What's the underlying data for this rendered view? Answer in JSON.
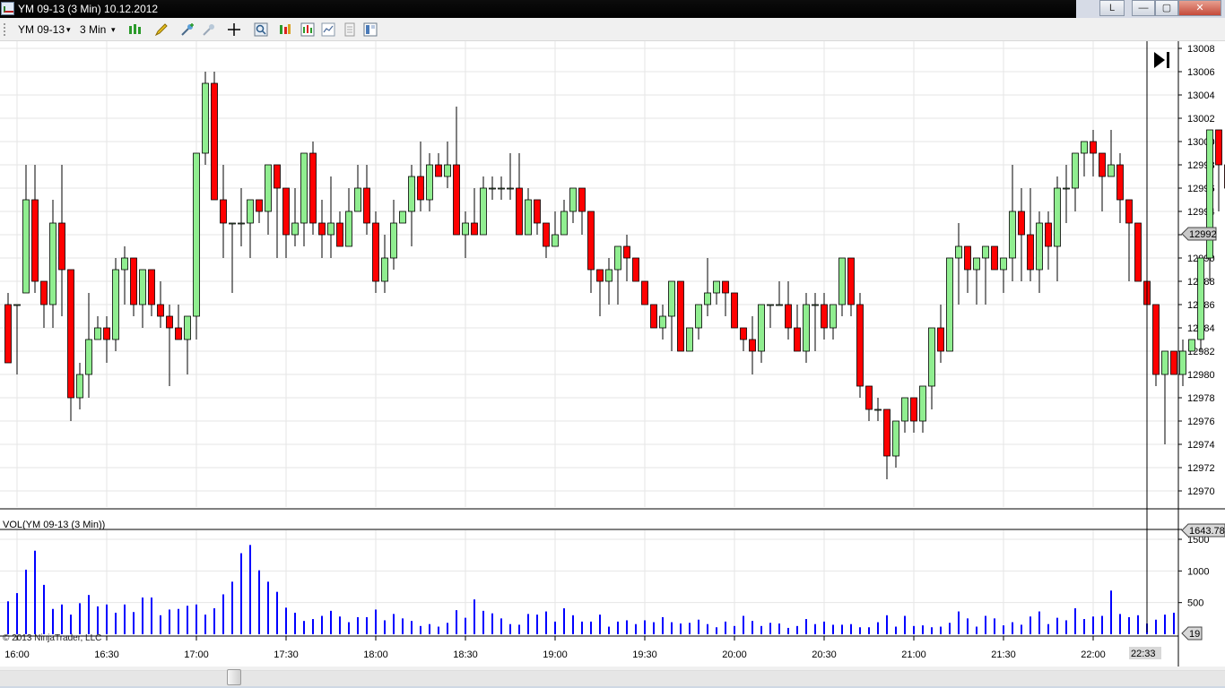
{
  "window": {
    "title": "YM 09-13 (3 Min)  10.12.2012",
    "layout_button": "L",
    "minimize": "—",
    "maximize": "▢",
    "close": "✕"
  },
  "toolbar": {
    "instrument": "YM 09-13",
    "interval": "3 Min",
    "dropdown_arrow": "▾",
    "icons": [
      "bar-type-icon",
      "drawing-tool-icon",
      "zoom-in-icon",
      "zoom-out-icon",
      "crosshair-icon",
      "search-icon",
      "chart-properties-icon",
      "indicators-icon",
      "strategies-icon",
      "data-box-icon",
      "chart-trader-icon"
    ]
  },
  "colors": {
    "up_fill": "#90ee90",
    "down_fill": "#ff0000",
    "volume": "#0000ff",
    "grid": "#e6e6e6",
    "crosshair": "#000000"
  },
  "chart_data": [
    {
      "type": "candlestick",
      "instrument": "YM 09-13",
      "interval": "3 Min",
      "xlabel": "",
      "ylabel": "",
      "ylim": [
        12969,
        13008
      ],
      "x_ticks": [
        "16:00",
        "16:30",
        "17:00",
        "17:30",
        "18:00",
        "18:30",
        "19:00",
        "19:30",
        "20:00",
        "20:30",
        "21:00",
        "21:30",
        "22:00"
      ],
      "y_ticks": [
        13008,
        13006,
        13004,
        13002,
        13000,
        12998,
        12996,
        12994,
        12992,
        12990,
        12988,
        12986,
        12984,
        12982,
        12980,
        12978,
        12976,
        12974,
        12972,
        12970
      ],
      "current_price_label": "12992",
      "current_time_label": "22:33",
      "ohlc": [
        [
          12986,
          12987,
          12981,
          12981
        ],
        [
          12986,
          12986,
          12980,
          12986
        ],
        [
          12987,
          12998,
          12987,
          12995
        ],
        [
          12995,
          12998,
          12987,
          12988
        ],
        [
          12988,
          12988,
          12984,
          12986
        ],
        [
          12986,
          12995,
          12984,
          12993
        ],
        [
          12993,
          12998,
          12985,
          12989
        ],
        [
          12989,
          12989,
          12976,
          12978
        ],
        [
          12978,
          12981,
          12977,
          12980
        ],
        [
          12980,
          12987,
          12978,
          12983
        ],
        [
          12983,
          12985,
          12983,
          12984
        ],
        [
          12984,
          12985,
          12981,
          12983
        ],
        [
          12983,
          12990,
          12982,
          12989
        ],
        [
          12989,
          12991,
          12986,
          12990
        ],
        [
          12990,
          12990,
          12985,
          12986
        ],
        [
          12986,
          12989,
          12984,
          12989
        ],
        [
          12989,
          12989,
          12985,
          12986
        ],
        [
          12986,
          12988,
          12984,
          12985
        ],
        [
          12985,
          12986,
          12979,
          12984
        ],
        [
          12984,
          12986,
          12983,
          12983
        ],
        [
          12983,
          12985,
          12980,
          12985
        ],
        [
          12985,
          12999,
          12983,
          12999
        ],
        [
          12999,
          13006,
          12998,
          13005
        ],
        [
          13005,
          13006,
          12995,
          12995
        ],
        [
          12995,
          12998,
          12990,
          12993
        ],
        [
          12993,
          12993,
          12987,
          12993
        ],
        [
          12993,
          12996,
          12991,
          12993
        ],
        [
          12993,
          12995,
          12990,
          12995
        ],
        [
          12995,
          12995,
          12993,
          12994
        ],
        [
          12994,
          12998,
          12992,
          12998
        ],
        [
          12998,
          12998,
          12990,
          12996
        ],
        [
          12996,
          12996,
          12990,
          12992
        ],
        [
          12992,
          12996,
          12991,
          12993
        ],
        [
          12993,
          12999,
          12991,
          12999
        ],
        [
          12999,
          13000,
          12992,
          12993
        ],
        [
          12993,
          12995,
          12990,
          12992
        ],
        [
          12992,
          12997,
          12990,
          12993
        ],
        [
          12993,
          12994,
          12991,
          12991
        ],
        [
          12991,
          12996,
          12991,
          12994
        ],
        [
          12994,
          12998,
          12994,
          12996
        ],
        [
          12996,
          12998,
          12992,
          12993
        ],
        [
          12993,
          12994,
          12987,
          12988
        ],
        [
          12988,
          12992,
          12987,
          12990
        ],
        [
          12990,
          12995,
          12989,
          12993
        ],
        [
          12993,
          12994,
          12993,
          12994
        ],
        [
          12994,
          12998,
          12991,
          12997
        ],
        [
          12997,
          13000,
          12994,
          12995
        ],
        [
          12995,
          12999,
          12994,
          12998
        ],
        [
          12998,
          12999,
          12997,
          12997
        ],
        [
          12997,
          13000,
          12996,
          12998
        ],
        [
          12998,
          13003,
          12992,
          12992
        ],
        [
          12992,
          12994,
          12990,
          12993
        ],
        [
          12993,
          12996,
          12992,
          12992
        ],
        [
          12992,
          12997,
          12992,
          12996
        ],
        [
          12996,
          12997,
          12995,
          12996
        ],
        [
          12996,
          12997,
          12995,
          12996
        ],
        [
          12996,
          12999,
          12995,
          12996
        ],
        [
          12996,
          12999,
          12992,
          12992
        ],
        [
          12992,
          12996,
          12994,
          12995
        ],
        [
          12995,
          12995,
          12992,
          12993
        ],
        [
          12993,
          12993,
          12990,
          12991
        ],
        [
          12991,
          12994,
          12991,
          12992
        ],
        [
          12992,
          12995,
          12992,
          12994
        ],
        [
          12994,
          12996,
          12993,
          12996
        ],
        [
          12996,
          12996,
          12992,
          12994
        ],
        [
          12994,
          12994,
          12987,
          12989
        ],
        [
          12989,
          12989,
          12985,
          12988
        ],
        [
          12988,
          12990,
          12986,
          12989
        ],
        [
          12989,
          12991,
          12986,
          12991
        ],
        [
          12991,
          12992,
          12988,
          12990
        ],
        [
          12990,
          12990,
          12988,
          12988
        ],
        [
          12988,
          12988,
          12986,
          12986
        ],
        [
          12986,
          12986,
          12984,
          12984
        ],
        [
          12984,
          12986,
          12983,
          12985
        ],
        [
          12985,
          12988,
          12982,
          12988
        ],
        [
          12988,
          12988,
          12982,
          12982
        ],
        [
          12982,
          12984,
          12982,
          12984
        ],
        [
          12984,
          12986,
          12983,
          12986
        ],
        [
          12986,
          12990,
          12985,
          12987
        ],
        [
          12987,
          12988,
          12986,
          12988
        ],
        [
          12988,
          12988,
          12985,
          12987
        ],
        [
          12987,
          12987,
          12985,
          12984
        ],
        [
          12984,
          12984,
          12982,
          12983
        ],
        [
          12983,
          12985,
          12980,
          12982
        ],
        [
          12982,
          12986,
          12981,
          12986
        ],
        [
          12986,
          12986,
          12984,
          12986
        ],
        [
          12986,
          12988,
          12986,
          12986
        ],
        [
          12986,
          12988,
          12983,
          12984
        ],
        [
          12984,
          12986,
          12982,
          12982
        ],
        [
          12982,
          12987,
          12981,
          12986
        ],
        [
          12986,
          12987,
          12982,
          12986
        ],
        [
          12986,
          12987,
          12983,
          12984
        ],
        [
          12984,
          12986,
          12983,
          12986
        ],
        [
          12986,
          12990,
          12985,
          12990
        ],
        [
          12990,
          12990,
          12985,
          12986
        ],
        [
          12986,
          12987,
          12978,
          12979
        ],
        [
          12979,
          12979,
          12976,
          12977
        ],
        [
          12977,
          12978,
          12976,
          12977
        ],
        [
          12977,
          12977,
          12971,
          12973
        ],
        [
          12973,
          12976,
          12972,
          12976
        ],
        [
          12976,
          12978,
          12975,
          12978
        ],
        [
          12978,
          12978,
          12975,
          12976
        ],
        [
          12976,
          12978,
          12975,
          12979
        ],
        [
          12979,
          12982,
          12977,
          12984
        ],
        [
          12984,
          12986,
          12981,
          12982
        ],
        [
          12982,
          12988,
          12982,
          12990
        ],
        [
          12990,
          12993,
          12986,
          12991
        ],
        [
          12991,
          12991,
          12987,
          12989
        ],
        [
          12989,
          12989,
          12986,
          12990
        ],
        [
          12990,
          12990,
          12986,
          12991
        ],
        [
          12991,
          12991,
          12989,
          12989
        ],
        [
          12989,
          12989,
          12987,
          12990
        ],
        [
          12990,
          12998,
          12988,
          12994
        ],
        [
          12994,
          12996,
          12988,
          12992
        ],
        [
          12992,
          12996,
          12988,
          12989
        ],
        [
          12989,
          12994,
          12987,
          12993
        ],
        [
          12993,
          12994,
          12989,
          12991
        ],
        [
          12991,
          12997,
          12988,
          12996
        ],
        [
          12996,
          12998,
          12993,
          12996
        ],
        [
          12996,
          12997,
          12994,
          12999
        ],
        [
          12999,
          13000,
          12997,
          13000
        ],
        [
          13000,
          13001,
          12997,
          12999
        ],
        [
          12999,
          12999,
          12994,
          12997
        ],
        [
          12997,
          13001,
          12997,
          12998
        ],
        [
          12998,
          12999,
          12993,
          12995
        ],
        [
          12995,
          12995,
          12988,
          12993
        ],
        [
          12993,
          12993,
          12988,
          12988
        ],
        [
          12988,
          12988,
          12985,
          12986
        ],
        [
          12986,
          12986,
          12979,
          12980
        ],
        [
          12980,
          12980,
          12974,
          12982
        ],
        [
          12982,
          12982,
          12980,
          12980
        ],
        [
          12980,
          12983,
          12979,
          12982
        ],
        [
          12982,
          12983,
          12982,
          12983
        ],
        [
          12983,
          12990,
          12982,
          12990
        ],
        [
          12990,
          13001,
          12988,
          13001
        ],
        [
          13001,
          12998,
          12994,
          12998
        ],
        [
          12998,
          12998,
          12994,
          12996
        ],
        [
          12996,
          12996,
          12994,
          12994
        ],
        [
          12994,
          12994,
          12990,
          12992
        ]
      ],
      "volume_bars": [
        [
          680,
          780,
          1200,
          1680,
          1060,
          740,
          940,
          470,
          810,
          1180,
          480,
          740,
          400,
          680,
          520,
          770,
          830,
          330,
          380,
          400,
          430,
          510,
          270,
          400,
          1200,
          1260,
          1020,
          870,
          740,
          400,
          340,
          350,
          250,
          310,
          330,
          210,
          540,
          140,
          260,
          330,
          210,
          330,
          0,
          130,
          310,
          220,
          120,
          170,
          560,
          550,
          380,
          350,
          220,
          120,
          180,
          580,
          130,
          470,
          230,
          210,
          130,
          280,
          180,
          180,
          170,
          180,
          200,
          160,
          170,
          200,
          180,
          200,
          170,
          140,
          170,
          210,
          140,
          480,
          210,
          200,
          180,
          160,
          190,
          150,
          140,
          130,
          180,
          180,
          230,
          150,
          280,
          300,
          310,
          190,
          130,
          230,
          100,
          240,
          120,
          200,
          100,
          130,
          160,
          120,
          120,
          140,
          160,
          100,
          130,
          200,
          120,
          180,
          130,
          150,
          100,
          120,
          190,
          310,
          110,
          610,
          530,
          260,
          180,
          140,
          100,
          400,
          300,
          300,
          260,
          230,
          220,
          620,
          400,
          460,
          120,
          230,
          470,
          140,
          560,
          420,
          480,
          310,
          310,
          200,
          240,
          540,
          470,
          160,
          190,
          180,
          400,
          350,
          240,
          620,
          580,
          480,
          680,
          430,
          740,
          150,
          640,
          500,
          500,
          280,
          520,
          0,
          0,
          0,
          0
        ]
      ],
      "volume": [
        520,
        650,
        1020,
        1320,
        780,
        400,
        470,
        310,
        490,
        620,
        440,
        470,
        340,
        470,
        350,
        580,
        580,
        300,
        390,
        400,
        450,
        470,
        310,
        410,
        630,
        830,
        1280,
        1410,
        1010,
        830,
        670,
        420,
        340,
        210,
        240,
        290,
        370,
        280,
        190,
        270,
        270,
        390,
        220,
        320,
        250,
        210,
        130,
        160,
        120,
        180,
        380,
        260,
        550,
        370,
        330,
        250,
        160,
        150,
        320,
        310,
        360,
        200,
        410,
        300,
        200,
        200,
        310,
        120,
        200,
        220,
        160,
        220,
        190,
        270,
        190,
        170,
        180,
        230,
        160,
        110,
        200,
        130,
        290,
        210,
        130,
        180,
        170,
        100,
        130,
        240,
        160,
        200,
        150,
        150,
        160,
        110,
        110,
        190,
        300,
        120,
        290,
        130,
        140,
        110,
        120,
        180,
        360,
        250,
        120,
        290,
        250,
        140,
        190,
        150,
        280,
        360,
        160,
        260,
        220,
        410,
        240,
        280,
        290,
        690,
        320,
        270,
        300,
        170,
        230,
        310,
        340,
        590,
        240,
        600,
        240,
        390,
        350,
        470,
        200,
        330,
        220,
        250,
        520,
        330,
        410,
        400,
        300,
        270,
        660,
        460,
        680,
        110,
        500,
        360,
        780,
        610,
        370,
        490,
        370,
        1060,
        740,
        270,
        190,
        470,
        380,
        0,
        50,
        50,
        50,
        50
      ],
      "volume_label": "VOL(YM 09-13 (3 Min))",
      "volume_y_ticks": [
        1500,
        1000,
        500
      ],
      "volume_current_label": "1643.78",
      "volume_last_label": "19",
      "copyright": "© 2013 NinjaTrader, LLC"
    }
  ]
}
